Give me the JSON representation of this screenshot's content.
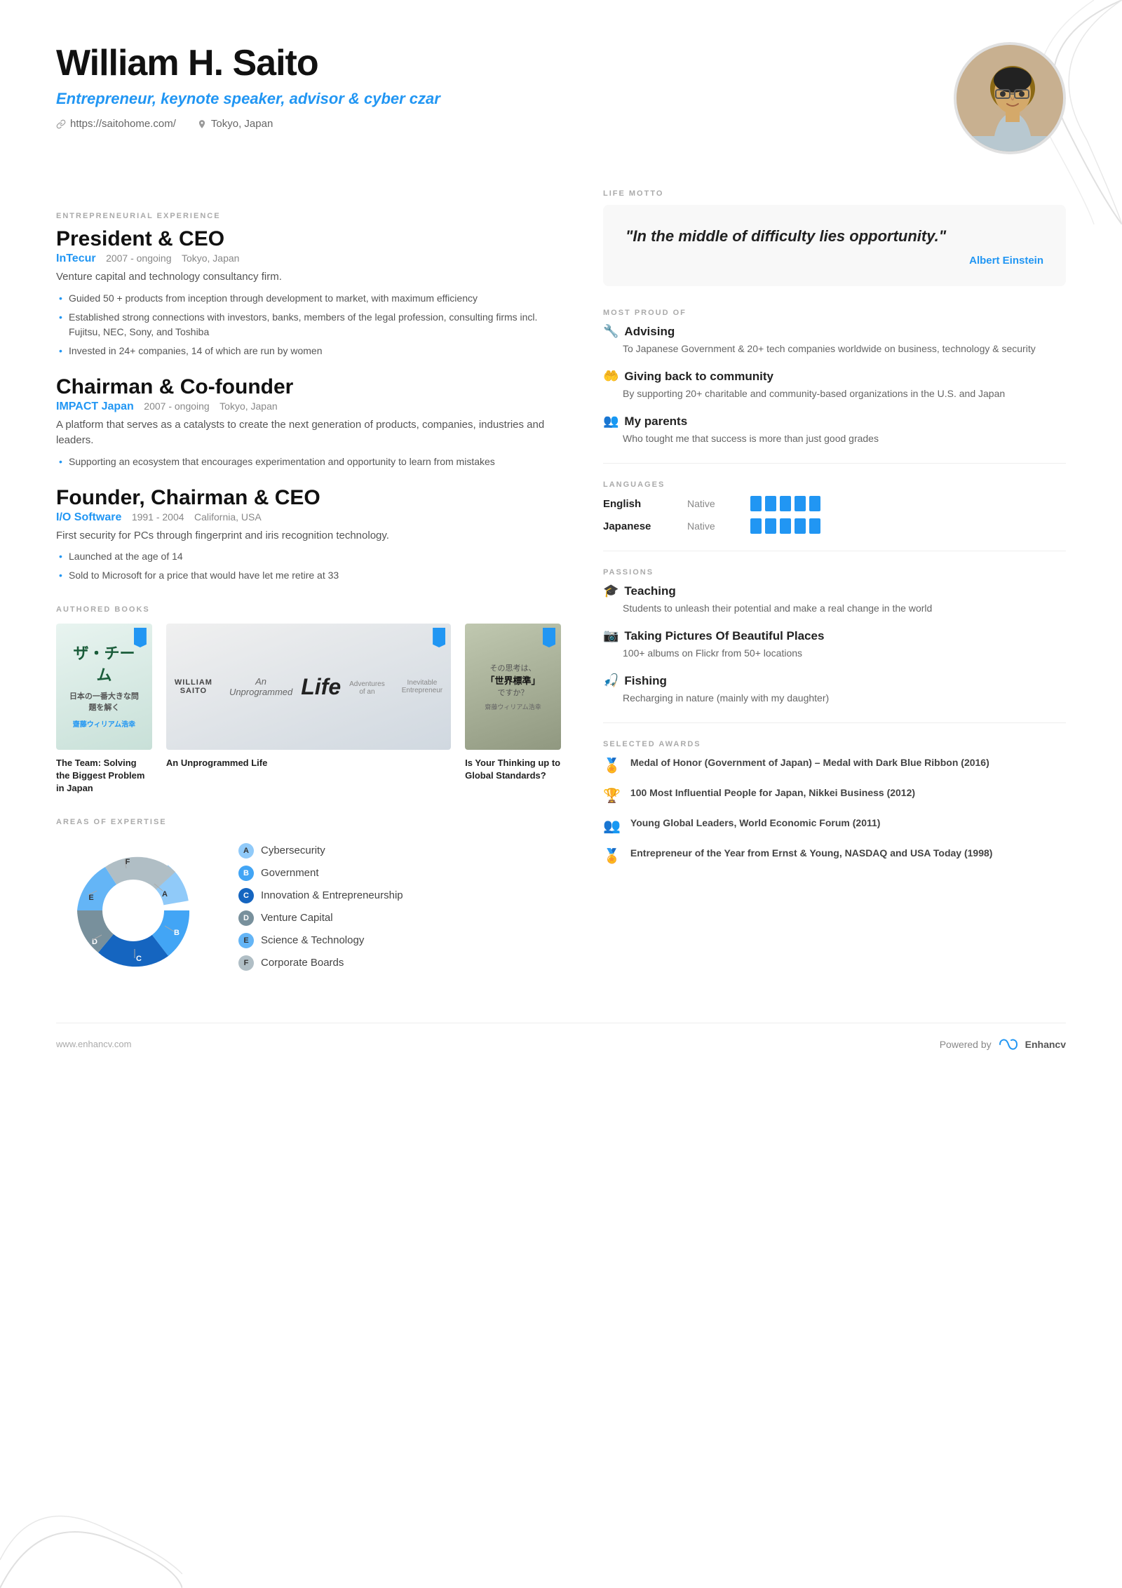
{
  "header": {
    "name": "William H. Saito",
    "title": "Entrepreneur, keynote speaker, advisor & cyber czar",
    "website": "https://saitohome.com/",
    "location": "Tokyo, Japan"
  },
  "life_motto": {
    "label": "LIFE MOTTO",
    "quote": "\"In the middle of difficulty lies opportunity.\"",
    "author": "Albert Einstein"
  },
  "most_proud_of": {
    "label": "MOST PROUD OF",
    "items": [
      {
        "icon": "🔧",
        "title": "Advising",
        "desc": "To Japanese Government & 20+ tech companies worldwide on business, technology & security"
      },
      {
        "icon": "🤲",
        "title": "Giving back to community",
        "desc": "By supporting 20+ charitable and community-based organizations in the U.S. and Japan"
      },
      {
        "icon": "👥",
        "title": "My parents",
        "desc": "Who tought me that success is more than just good grades"
      }
    ]
  },
  "languages": {
    "label": "LANGUAGES",
    "items": [
      {
        "name": "English",
        "level": "Native",
        "bars": 5
      },
      {
        "name": "Japanese",
        "level": "Native",
        "bars": 5
      }
    ]
  },
  "passions": {
    "label": "PASSIONS",
    "items": [
      {
        "icon": "🎓",
        "title": "Teaching",
        "desc": "Students to unleash their potential and make a real change in the world"
      },
      {
        "icon": "📷",
        "title": "Taking Pictures Of Beautiful Places",
        "desc": "100+ albums on Flickr from 50+ locations"
      },
      {
        "icon": "🎣",
        "title": "Fishing",
        "desc": "Recharging in nature (mainly with my daughter)"
      }
    ]
  },
  "selected_awards": {
    "label": "SELECTED AWARDS",
    "items": [
      {
        "icon": "🏅",
        "text": "Medal of Honor (Government of Japan) – Medal with Dark Blue Ribbon (2016)"
      },
      {
        "icon": "🏆",
        "text": "100 Most Influential People for Japan, Nikkei Business (2012)"
      },
      {
        "icon": "👥",
        "text": "Young Global Leaders, World Economic Forum (2011)"
      },
      {
        "icon": "🏅",
        "text": "Entrepreneur of the Year from Ernst & Young, NASDAQ and USA Today (1998)"
      }
    ]
  },
  "entrepreneurial_experience": {
    "label": "ENTREPRENEURIAL EXPERIENCE",
    "positions": [
      {
        "title": "President & CEO",
        "company": "InTecur",
        "years": "2007 - ongoing",
        "location": "Tokyo, Japan",
        "desc": "Venture capital and technology consultancy firm.",
        "bullets": [
          "Guided 50 + products from inception through development to market, with maximum efficiency",
          "Established strong connections with investors, banks, members of the legal profession, consulting firms incl. Fujitsu, NEC, Sony, and Toshiba",
          "Invested in 24+ companies, 14 of which are run by women"
        ]
      },
      {
        "title": "Chairman & Co-founder",
        "company": "IMPACT Japan",
        "years": "2007 - ongoing",
        "location": "Tokyo, Japan",
        "desc": "A platform that serves as a catalysts to create the next generation of products, companies, industries and leaders.",
        "bullets": [
          "Supporting an ecosystem that encourages experimentation and opportunity to learn from mistakes"
        ]
      },
      {
        "title": "Founder, Chairman & CEO",
        "company": "I/O Software",
        "years": "1991 - 2004",
        "location": "California, USA",
        "desc": "First security for PCs through fingerprint and iris recognition technology.",
        "bullets": [
          "Launched at the age of 14",
          "Sold to Microsoft for a price that would have let me retire at 33"
        ]
      }
    ]
  },
  "authored_books": {
    "label": "AUTHORED BOOKS",
    "books": [
      {
        "title": "The Team: Solving the Biggest Problem in Japan",
        "cover_text": "ザ・チーム"
      },
      {
        "title": "An Unprogrammed Life",
        "cover_text": "An Unprogrammed Life"
      },
      {
        "title": "Is Your Thinking up to Global Standards?",
        "cover_text": "世界標準ですか？"
      }
    ]
  },
  "areas_of_expertise": {
    "label": "AREAS OF EXPERTISE",
    "items": [
      {
        "letter": "A",
        "label": "Cybersecurity",
        "color": "#90CAF9",
        "value": 20
      },
      {
        "letter": "B",
        "label": "Government",
        "color": "#42A5F5",
        "value": 18
      },
      {
        "letter": "C",
        "label": "Innovation & Entrepreneurship",
        "color": "#1565C0",
        "value": 16
      },
      {
        "letter": "D",
        "label": "Venture Capital",
        "color": "#78909C",
        "value": 15
      },
      {
        "letter": "E",
        "label": "Science & Technology",
        "color": "#64B5F6",
        "value": 17
      },
      {
        "letter": "F",
        "label": "Corporate Boards",
        "color": "#B0BEC5",
        "value": 14
      }
    ]
  },
  "footer": {
    "website": "www.enhancv.com",
    "powered_by": "Powered by",
    "brand": "Enhancv"
  }
}
